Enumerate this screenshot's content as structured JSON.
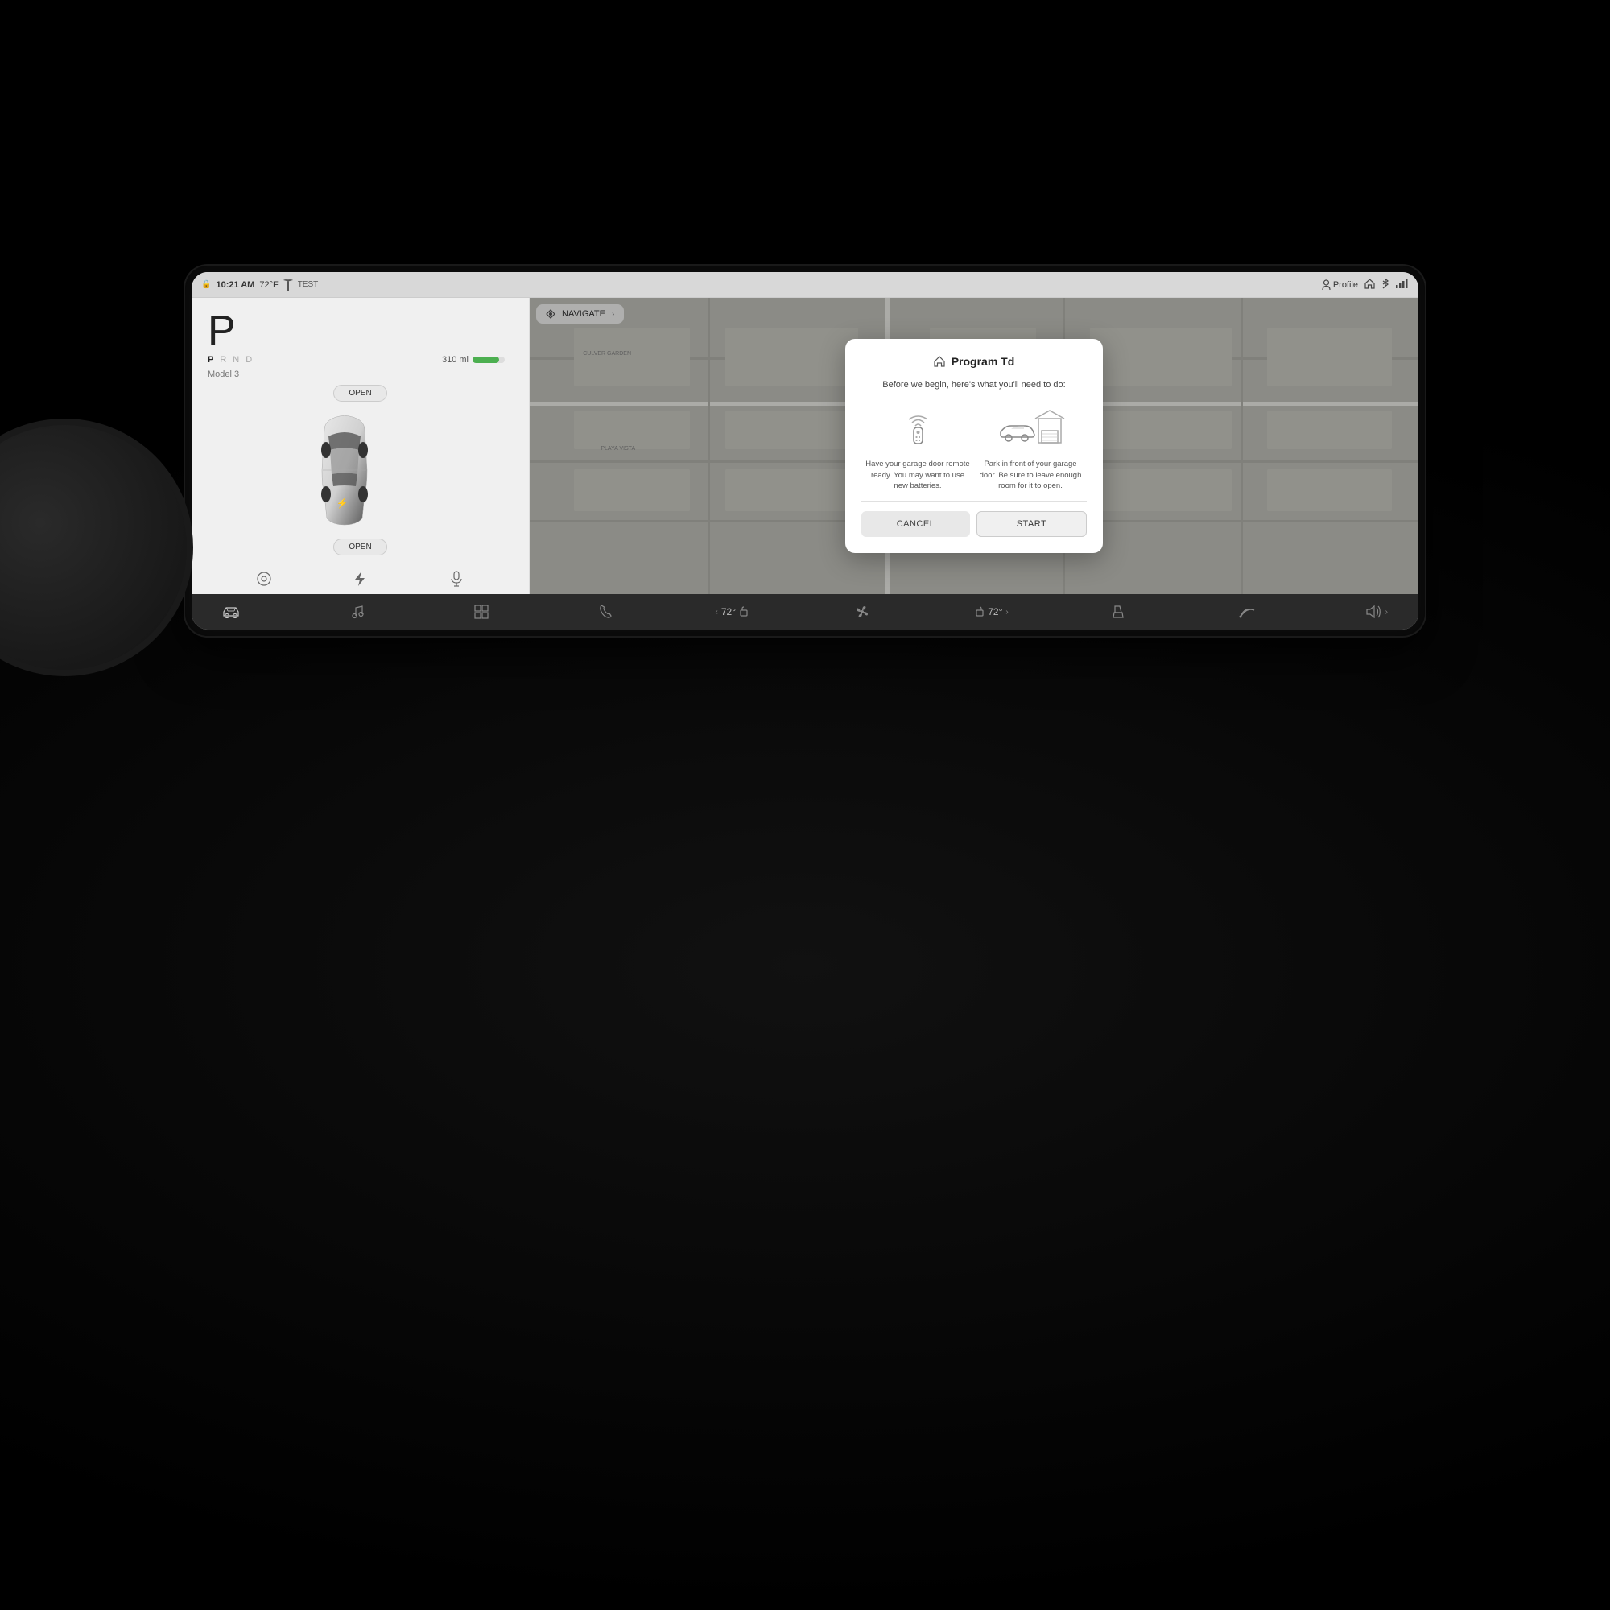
{
  "scene": {
    "background": "#000"
  },
  "statusBar": {
    "lock_icon": "🔒",
    "time": "10:21 AM",
    "temp": "72°F",
    "tag": "TEST",
    "profile_label": "Profile",
    "home_icon": "⌂",
    "bluetooth_icon": "⬡",
    "signal_icon": "▐"
  },
  "leftPanel": {
    "park_letter": "P",
    "gears": [
      "P",
      "R",
      "N",
      "D"
    ],
    "active_gear": "P",
    "range": "310 mi",
    "battery_percent": 82,
    "model_name": "Model 3",
    "open_top_label": "OPEN",
    "open_bottom_label": "OPEN",
    "fan_icon": "❄",
    "fan_label": ""
  },
  "bottomControls": {
    "icon1": "◎",
    "icon2": "⚡",
    "icon3": "🎤"
  },
  "navigateBar": {
    "nav_icon": "⊕",
    "label": "NAVIGATE",
    "arrow": "›"
  },
  "modal": {
    "home_icon": "⌂",
    "title": "Program Td",
    "subtitle": "Before we begin, here's what you'll need to do:",
    "icon1_alt": "garage-remote-icon",
    "icon1_description": "Have your garage door remote ready. You may want to use new batteries.",
    "icon2_alt": "car-garage-icon",
    "icon2_description": "Park in front of your garage door. Be sure to leave enough room for it to open.",
    "cancel_label": "CANCEL",
    "start_label": "START"
  },
  "taskbar": {
    "items": [
      {
        "id": "car",
        "icon": "🚗",
        "label": "car"
      },
      {
        "id": "music",
        "icon": "♪",
        "label": "music"
      },
      {
        "id": "apps",
        "icon": "⊞",
        "label": "apps"
      },
      {
        "id": "phone",
        "icon": "📞",
        "label": "phone"
      },
      {
        "id": "temp-left",
        "label": "72°",
        "type": "temp"
      },
      {
        "id": "fan",
        "icon": "❄",
        "label": "fan"
      },
      {
        "id": "temp-right",
        "label": "72°",
        "type": "temp"
      },
      {
        "id": "seat",
        "icon": "⊏",
        "label": "seat"
      },
      {
        "id": "wiper",
        "icon": "⌒",
        "label": "wiper"
      },
      {
        "id": "volume",
        "icon": "🔊",
        "label": "volume"
      }
    ]
  }
}
